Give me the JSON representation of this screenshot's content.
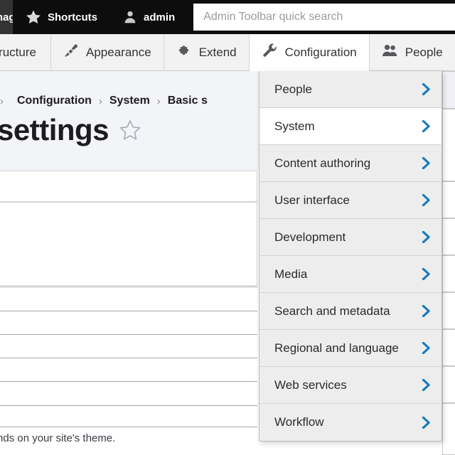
{
  "admin_toolbar": {
    "home_label": "Manage",
    "shortcuts_label": "Shortcuts",
    "shortcuts_icon": "star-icon",
    "user_label": "admin",
    "user_icon": "person-icon",
    "search_placeholder": "Admin Toolbar quick search",
    "search_value": ""
  },
  "menu_bar": {
    "tabs": [
      {
        "label": "Structure",
        "icon": "structure-icon",
        "active": false
      },
      {
        "label": "Appearance",
        "icon": "paintbrush-icon",
        "active": false
      },
      {
        "label": "Extend",
        "icon": "puzzle-icon",
        "active": false
      },
      {
        "label": "Configuration",
        "icon": "wrench-icon",
        "active": true
      },
      {
        "label": "People",
        "icon": "people-icon",
        "active": false
      }
    ]
  },
  "page": {
    "breadcrumb": [
      "Configuration",
      "System",
      "Basic s"
    ],
    "breadcrumb_separator": "›",
    "title": "settings",
    "star_icon": "star-outline-icon",
    "help_text": "nds on your site's theme."
  },
  "configuration_menu": {
    "items": [
      {
        "label": "People",
        "active": false,
        "chevron": "chevron-right-icon"
      },
      {
        "label": "System",
        "active": true,
        "chevron": "chevron-right-icon"
      },
      {
        "label": "Content authoring",
        "active": false,
        "chevron": "chevron-right-icon"
      },
      {
        "label": "User interface",
        "active": false,
        "chevron": "chevron-right-icon"
      },
      {
        "label": "Development",
        "active": false,
        "chevron": "chevron-right-icon"
      },
      {
        "label": "Media",
        "active": false,
        "chevron": "chevron-right-icon"
      },
      {
        "label": "Search and metadata",
        "active": false,
        "chevron": "chevron-right-icon"
      },
      {
        "label": "Regional and language",
        "active": false,
        "chevron": "chevron-right-icon"
      },
      {
        "label": "Web services",
        "active": false,
        "chevron": "chevron-right-icon"
      },
      {
        "label": "Workflow",
        "active": false,
        "chevron": "chevron-right-icon"
      }
    ]
  },
  "colors": {
    "toolbar_bg": "#0d0d0d",
    "toolbar_home_bg": "#333333",
    "menu_bar_bg": "#f2f2f2",
    "page_head_bg": "#f3f4f8",
    "flyout_bg": "#ededed",
    "flyout_active_bg": "#ffffff",
    "chevron_blue": "#1a7bbd",
    "text_dark": "#1b1b21"
  }
}
